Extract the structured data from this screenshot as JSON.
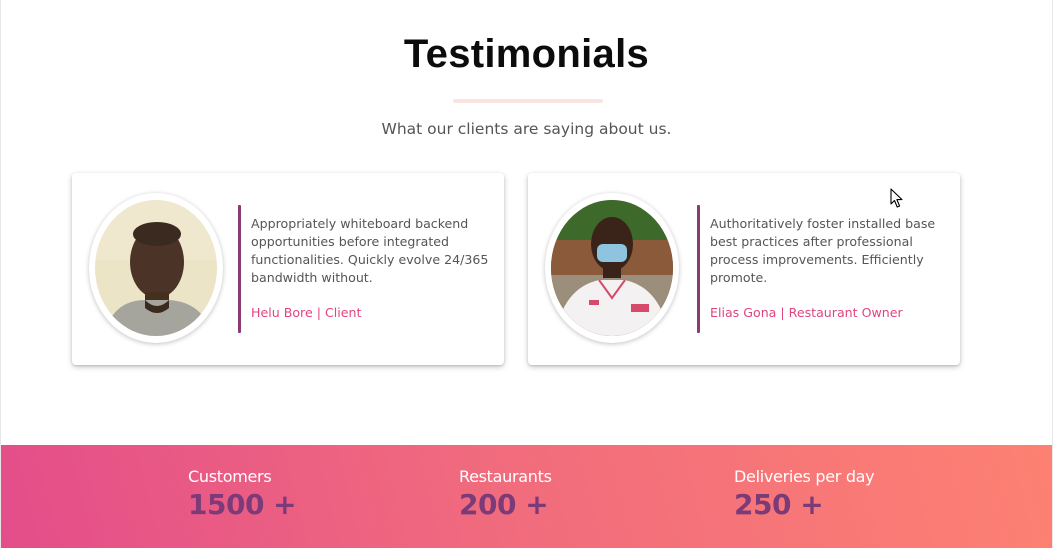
{
  "section": {
    "title": "Testimonials",
    "subtitle": "What our clients are saying about us."
  },
  "testimonials": [
    {
      "quote": "Appropriately whiteboard backend opportunities before integrated functionalities. Quickly evolve 24/365 bandwidth without.",
      "author": "Helu Bore | Client"
    },
    {
      "quote": "Authoritatively foster installed base best practices after professional process improvements. Efficiently promote.",
      "author": "Elias Gona | Restaurant Owner"
    }
  ],
  "stats": [
    {
      "label": "Customers",
      "value": "1500 +"
    },
    {
      "label": "Restaurants",
      "value": "200 +"
    },
    {
      "label": "Deliveries per day",
      "value": "250 +"
    }
  ],
  "colors": {
    "accent": "#e0457f",
    "quote_bar": "#8b3a74",
    "stat_value": "#7b3a78",
    "gradient_start": "#e44d8a",
    "gradient_end": "#fd8172"
  }
}
